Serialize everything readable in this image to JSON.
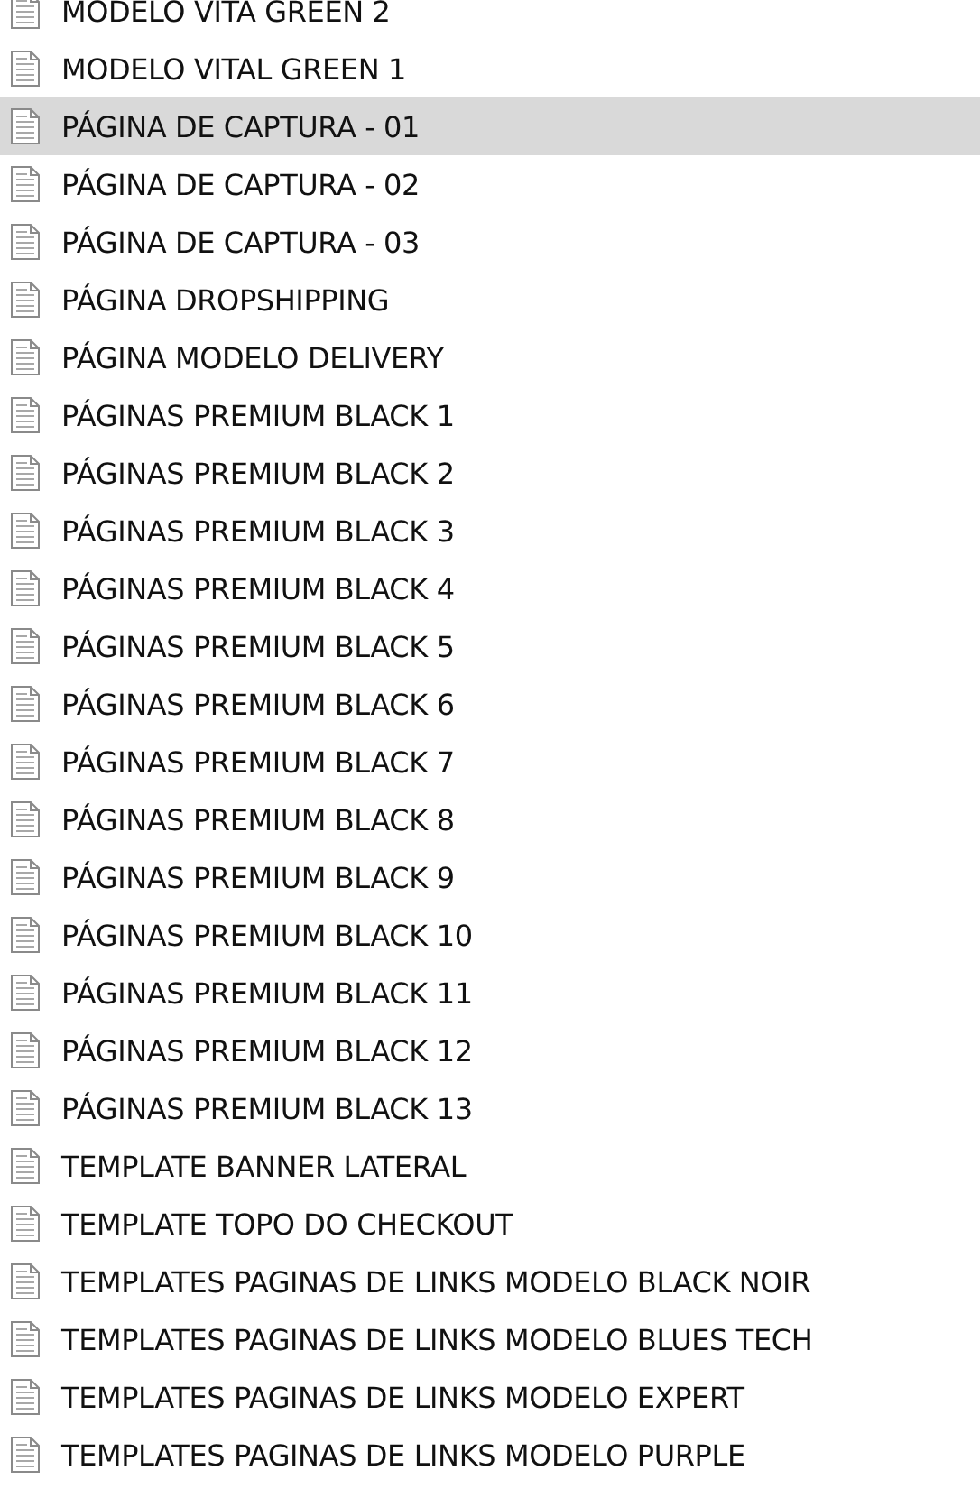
{
  "files": [
    {
      "name": "MODELO VITA GREEN 2",
      "selected": false
    },
    {
      "name": "MODELO VITAL GREEN 1",
      "selected": false
    },
    {
      "name": "PÁGINA DE CAPTURA - 01",
      "selected": true
    },
    {
      "name": "PÁGINA DE CAPTURA - 02",
      "selected": false
    },
    {
      "name": "PÁGINA DE CAPTURA - 03",
      "selected": false
    },
    {
      "name": "PÁGINA DROPSHIPPING",
      "selected": false
    },
    {
      "name": "PÁGINA MODELO DELIVERY",
      "selected": false
    },
    {
      "name": "PÁGINAS PREMIUM BLACK 1",
      "selected": false
    },
    {
      "name": "PÁGINAS PREMIUM BLACK 2",
      "selected": false
    },
    {
      "name": "PÁGINAS PREMIUM BLACK 3",
      "selected": false
    },
    {
      "name": "PÁGINAS PREMIUM BLACK 4",
      "selected": false
    },
    {
      "name": "PÁGINAS PREMIUM BLACK 5",
      "selected": false
    },
    {
      "name": "PÁGINAS PREMIUM BLACK 6",
      "selected": false
    },
    {
      "name": "PÁGINAS PREMIUM BLACK 7",
      "selected": false
    },
    {
      "name": "PÁGINAS PREMIUM BLACK 8",
      "selected": false
    },
    {
      "name": "PÁGINAS PREMIUM BLACK 9",
      "selected": false
    },
    {
      "name": "PÁGINAS PREMIUM BLACK 10",
      "selected": false
    },
    {
      "name": "PÁGINAS PREMIUM BLACK 11",
      "selected": false
    },
    {
      "name": "PÁGINAS PREMIUM BLACK 12",
      "selected": false
    },
    {
      "name": "PÁGINAS PREMIUM BLACK 13",
      "selected": false
    },
    {
      "name": "TEMPLATE BANNER LATERAL",
      "selected": false
    },
    {
      "name": "TEMPLATE TOPO DO CHECKOUT",
      "selected": false
    },
    {
      "name": "TEMPLATES PAGINAS DE LINKS MODELO BLACK NOIR",
      "selected": false
    },
    {
      "name": "TEMPLATES PAGINAS DE LINKS MODELO BLUES TECH",
      "selected": false
    },
    {
      "name": "TEMPLATES PAGINAS DE LINKS MODELO EXPERT",
      "selected": false
    },
    {
      "name": "TEMPLATES PAGINAS DE LINKS MODELO PURPLE",
      "selected": false
    }
  ]
}
